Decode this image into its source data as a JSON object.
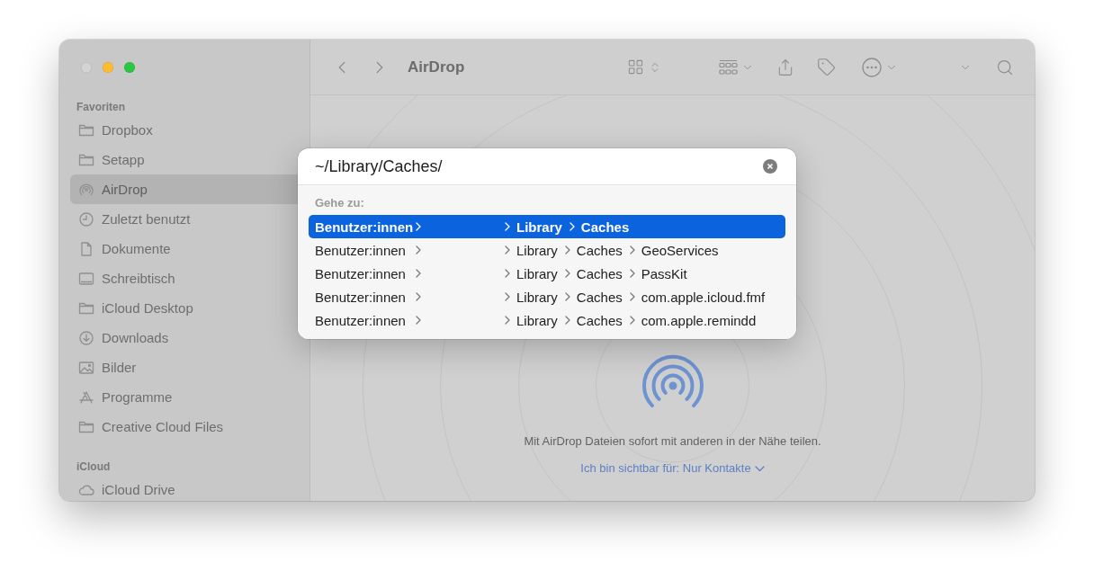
{
  "window": {
    "controls": [
      {
        "kind": "close",
        "disabled": true
      },
      {
        "kind": "minimize",
        "disabled": false
      },
      {
        "kind": "zoom",
        "disabled": false
      }
    ]
  },
  "sidebar": {
    "sections": [
      {
        "title": "Favoriten",
        "items": [
          {
            "label": "Dropbox",
            "kind": "folder",
            "selected": false
          },
          {
            "label": "Setapp",
            "kind": "folder",
            "selected": false
          },
          {
            "label": "AirDrop",
            "kind": "airdrop",
            "selected": true
          },
          {
            "label": "Zuletzt benutzt",
            "kind": "recent",
            "selected": false
          },
          {
            "label": "Dokumente",
            "kind": "document",
            "selected": false
          },
          {
            "label": "Schreibtisch",
            "kind": "desktop",
            "selected": false
          },
          {
            "label": "iCloud Desktop",
            "kind": "folder",
            "selected": false
          },
          {
            "label": "Downloads",
            "kind": "download",
            "selected": false
          },
          {
            "label": "Bilder",
            "kind": "pictures",
            "selected": false
          },
          {
            "label": "Programme",
            "kind": "apps",
            "selected": false
          },
          {
            "label": "Creative Cloud Files",
            "kind": "folder",
            "selected": false
          }
        ]
      },
      {
        "title": "iCloud",
        "items": [
          {
            "label": "iCloud Drive",
            "kind": "cloud",
            "selected": false
          }
        ]
      }
    ]
  },
  "toolbar": {
    "title": "AirDrop"
  },
  "airdrop": {
    "message": "Mit AirDrop Dateien sofort mit anderen in der Nähe teilen.",
    "visibility": "Ich bin sichtbar für: Nur Kontakte"
  },
  "go_to_dialog": {
    "value": "~/Library/Caches/",
    "section_label": "Gehe zu:",
    "suggestions": [
      {
        "selected": true,
        "segments": [
          "Benutzer:innen",
          "Library",
          "Caches"
        ]
      },
      {
        "selected": false,
        "segments": [
          "Benutzer:innen",
          "Library",
          "Caches",
          "GeoServices"
        ]
      },
      {
        "selected": false,
        "segments": [
          "Benutzer:innen",
          "Library",
          "Caches",
          "PassKit"
        ]
      },
      {
        "selected": false,
        "segments": [
          "Benutzer:innen",
          "Library",
          "Caches",
          "com.apple.icloud.fmf"
        ]
      },
      {
        "selected": false,
        "segments": [
          "Benutzer:innen",
          "Library",
          "Caches",
          "com.apple.remindd"
        ]
      }
    ]
  }
}
